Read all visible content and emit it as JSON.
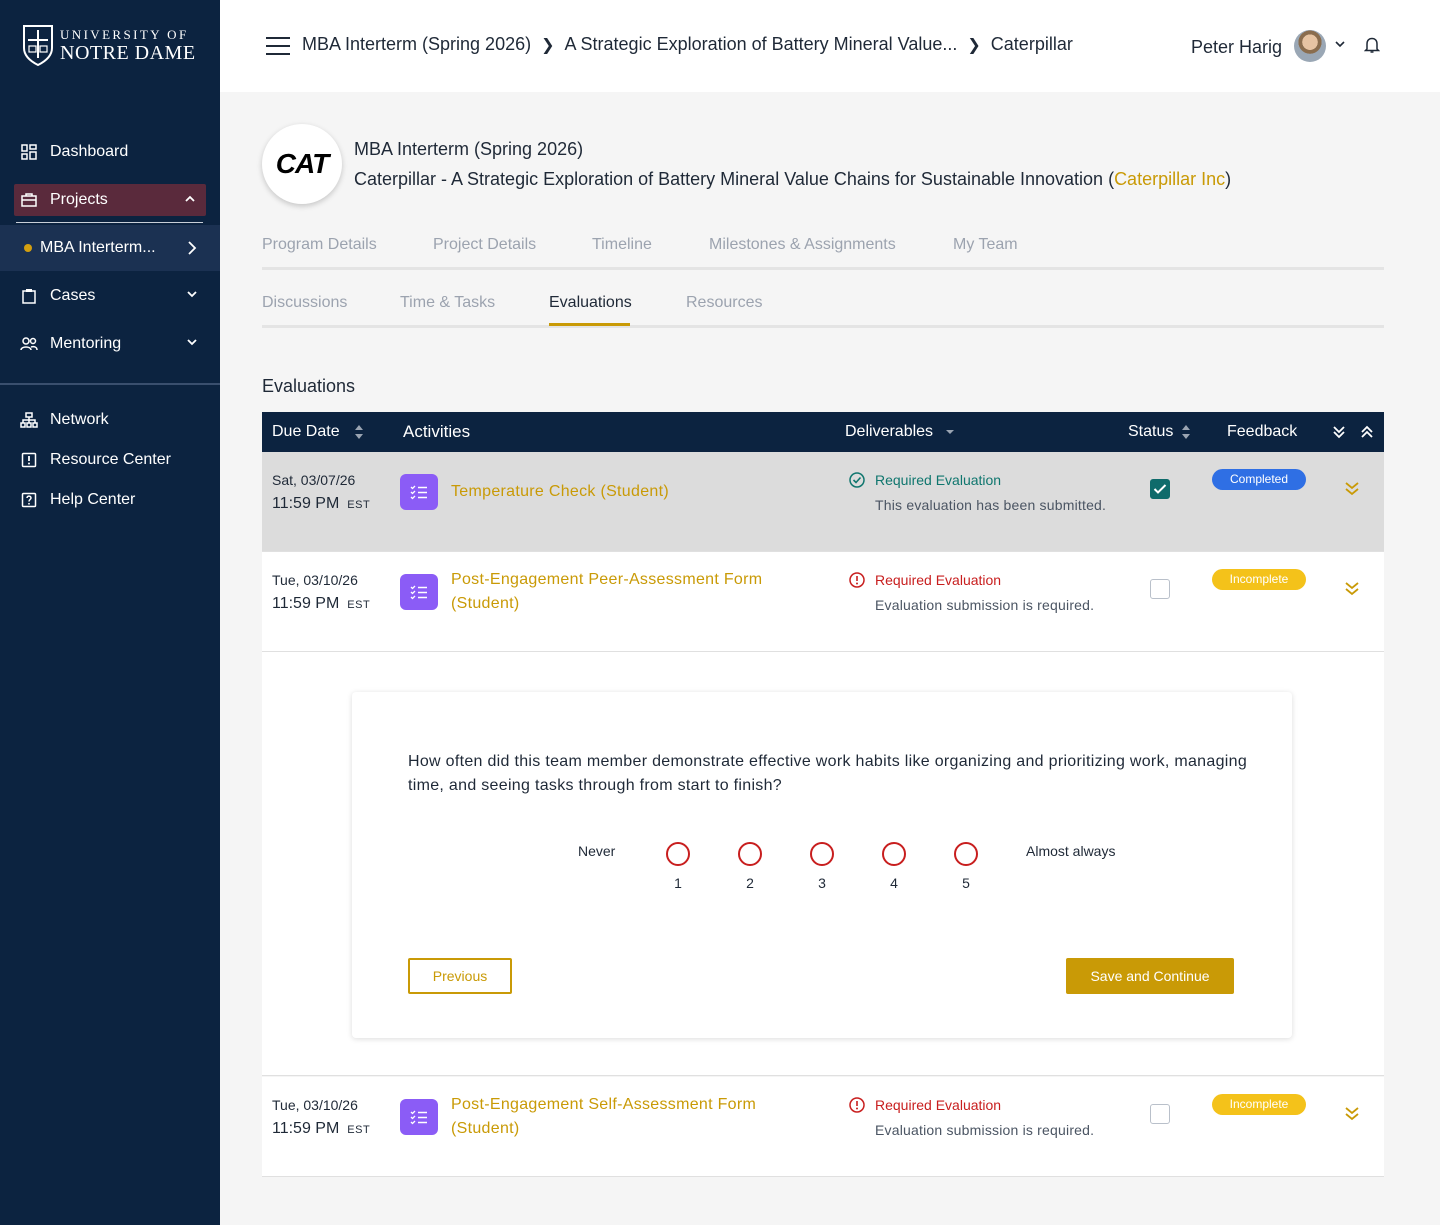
{
  "logo": {
    "line1": "UNIVERSITY OF",
    "line2": "NOTRE DAME"
  },
  "sidebar": {
    "items": [
      {
        "label": "Dashboard",
        "icon": "grid-icon"
      },
      {
        "label": "Projects",
        "icon": "briefcase-icon"
      },
      {
        "label": "Cases",
        "icon": "clipboard-icon"
      },
      {
        "label": "Mentoring",
        "icon": "users-icon"
      },
      {
        "label": "Network",
        "icon": "sitemap-icon"
      },
      {
        "label": "Resource Center",
        "icon": "alert-square-icon"
      },
      {
        "label": "Help Center",
        "icon": "question-square-icon"
      }
    ],
    "sub_item": "MBA Interterm..."
  },
  "header": {
    "breadcrumbs": [
      "MBA Interterm (Spring 2026)",
      "A Strategic Exploration of Battery Mineral Value...",
      "Caterpillar"
    ],
    "user_name": "Peter Harig"
  },
  "project": {
    "logo_text_1": "CAT",
    "program": "MBA Interterm (Spring 2026)",
    "title": "Caterpillar - A Strategic Exploration of Battery Mineral Value Chains for Sustainable Innovation (",
    "company": "Caterpillar Inc",
    "title_end": ")"
  },
  "tabs_row1": [
    "Program Details",
    "Project Details",
    "Timeline",
    "Milestones & Assignments",
    "My Team"
  ],
  "tabs_row2": [
    "Discussions",
    "Time & Tasks",
    "Evaluations",
    "Resources"
  ],
  "section_title": "Evaluations",
  "table": {
    "headers": {
      "due_date": "Due Date",
      "activities": "Activities",
      "deliverables": "Deliverables",
      "status": "Status",
      "feedback": "Feedback"
    },
    "rows": [
      {
        "date": "Sat, 03/07/26",
        "time": "11:59 PM",
        "tz": "EST",
        "activity": "Temperature Check (Student)",
        "deliverable_title": "Required Evaluation",
        "deliverable_sub": "This evaluation has been submitted.",
        "checked": true,
        "feedback": "Completed"
      },
      {
        "date": "Tue, 03/10/26",
        "time": "11:59 PM",
        "tz": "EST",
        "activity_line1": "Post-Engagement Peer-Assessment Form",
        "activity_line2": "(Student)",
        "deliverable_title": "Required Evaluation",
        "deliverable_sub": "Evaluation submission is required.",
        "checked": false,
        "feedback": "Incomplete"
      },
      {
        "date": "Tue, 03/10/26",
        "time": "11:59 PM",
        "tz": "EST",
        "activity_line1": "Post-Engagement Self-Assessment Form",
        "activity_line2": "(Student)",
        "deliverable_title": "Required Evaluation",
        "deliverable_sub": "Evaluation submission is required.",
        "checked": false,
        "feedback": "Incomplete"
      }
    ]
  },
  "evaluation": {
    "question": "How often did this team member demonstrate effective work habits like organizing and prioritizing work, managing time, and seeing tasks through from start to finish?",
    "scale_min_label": "Never",
    "scale_max_label": "Almost always",
    "options": [
      "1",
      "2",
      "3",
      "4",
      "5"
    ],
    "previous_label": "Previous",
    "save_label": "Save and Continue"
  },
  "colors": {
    "navy": "#0c2340",
    "gold": "#c99a06",
    "success": "#0f766e",
    "error": "#c81e1e",
    "completed": "#2f6fe4",
    "incomplete": "#f4c21a",
    "activity_icon": "#8b5cf6"
  }
}
